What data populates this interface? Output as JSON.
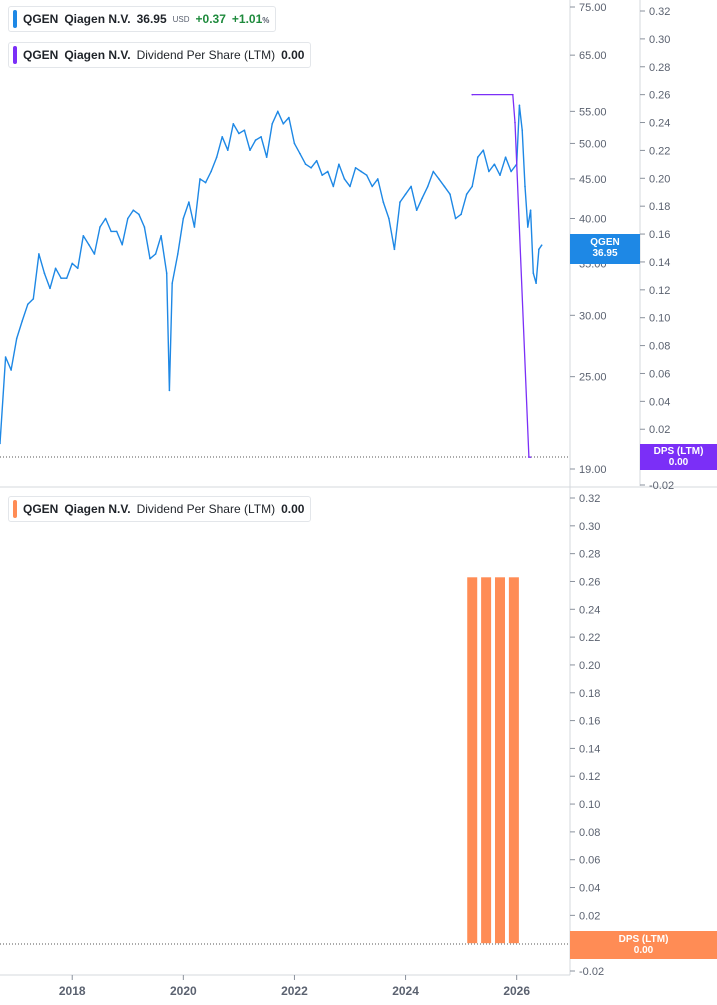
{
  "legends": [
    {
      "symbol": "QGEN",
      "name": "Qiagen N.V.",
      "value": "36.95",
      "currency": "USD",
      "change": "+0.37",
      "change_pct": "+1.01",
      "pct_sign": "%",
      "color": "#1e88e5",
      "change_color": "#1e8a3c"
    },
    {
      "symbol": "QGEN",
      "name": "Qiagen N.V.",
      "metric": "Dividend Per Share (LTM)",
      "value": "0.00",
      "color": "#7b2ff7"
    },
    {
      "symbol": "QGEN",
      "name": "Qiagen N.V.",
      "metric": "Dividend Per Share (LTM)",
      "value": "0.00",
      "color": "#ff8c55"
    }
  ],
  "tags": {
    "price": {
      "line1": "QGEN",
      "line2": "36.95",
      "color": "#1e88e5"
    },
    "dps_top": {
      "line1": "DPS (LTM)",
      "line2": "0.00",
      "color": "#7b2ff7"
    },
    "dps_bottom": {
      "line1": "DPS (LTM)",
      "line2": "0.00",
      "color": "#ff8c55"
    }
  },
  "chart_data": [
    {
      "type": "line",
      "series": [
        {
          "name": "Qiagen N.V.",
          "color": "#1e88e5"
        }
      ],
      "y_scale": "log",
      "y_ticks": [
        19.0,
        25.0,
        30.0,
        35.0,
        40.0,
        45.0,
        50.0,
        55.0,
        65.0,
        75.0
      ],
      "x_ticks": [
        "2018",
        "2020",
        "2022",
        "2024",
        "2026"
      ],
      "x": [
        2016.7,
        2016.8,
        2016.9,
        2017.0,
        2017.1,
        2017.2,
        2017.3,
        2017.4,
        2017.5,
        2017.6,
        2017.7,
        2017.8,
        2017.9,
        2018.0,
        2018.1,
        2018.2,
        2018.3,
        2018.4,
        2018.5,
        2018.6,
        2018.7,
        2018.8,
        2018.9,
        2019.0,
        2019.1,
        2019.2,
        2019.3,
        2019.4,
        2019.5,
        2019.6,
        2019.7,
        2019.75,
        2019.8,
        2019.9,
        2020.0,
        2020.1,
        2020.2,
        2020.3,
        2020.4,
        2020.5,
        2020.6,
        2020.7,
        2020.8,
        2020.9,
        2021.0,
        2021.1,
        2021.2,
        2021.3,
        2021.4,
        2021.5,
        2021.6,
        2021.7,
        2021.8,
        2021.9,
        2022.0,
        2022.1,
        2022.2,
        2022.3,
        2022.4,
        2022.5,
        2022.6,
        2022.7,
        2022.8,
        2022.9,
        2023.0,
        2023.1,
        2023.2,
        2023.3,
        2023.4,
        2023.5,
        2023.6,
        2023.7,
        2023.8,
        2023.9,
        2024.0,
        2024.1,
        2024.2,
        2024.3,
        2024.4,
        2024.5,
        2024.6,
        2024.7,
        2024.8,
        2024.9,
        2025.0,
        2025.1,
        2025.2,
        2025.3,
        2025.4,
        2025.5,
        2025.6,
        2025.7,
        2025.8,
        2025.9,
        2026.0,
        2026.05,
        2026.1,
        2026.15,
        2026.2,
        2026.25,
        2026.3,
        2026.35,
        2026.4,
        2026.45
      ],
      "y": [
        20.5,
        26.5,
        25.5,
        28.0,
        29.5,
        31.0,
        31.5,
        36.0,
        34.0,
        32.5,
        34.5,
        33.5,
        33.5,
        35.0,
        34.5,
        38.0,
        37.0,
        36.0,
        39.0,
        40.0,
        38.5,
        38.5,
        37.0,
        40.0,
        41.0,
        40.5,
        39.0,
        35.5,
        36.0,
        38.0,
        34.0,
        24.0,
        33.0,
        36.0,
        40.0,
        42.0,
        39.0,
        45.0,
        44.5,
        46.0,
        48.0,
        51.0,
        49.0,
        53.0,
        51.5,
        52.0,
        49.0,
        50.5,
        51.0,
        48.0,
        53.0,
        55.0,
        53.0,
        54.0,
        50.0,
        48.5,
        47.0,
        46.5,
        47.5,
        45.5,
        46.0,
        44.0,
        47.0,
        45.0,
        44.0,
        46.5,
        46.0,
        45.5,
        44.0,
        45.0,
        42.0,
        40.0,
        36.5,
        42.0,
        43.0,
        44.0,
        41.0,
        42.5,
        44.0,
        46.0,
        45.0,
        44.0,
        43.0,
        40.0,
        40.5,
        43.0,
        44.0,
        48.0,
        49.0,
        46.0,
        47.0,
        45.5,
        48.0,
        46.0,
        47.0,
        56.0,
        52.0,
        44.0,
        39.0,
        41.0,
        34.0,
        33.0,
        36.5,
        36.95
      ]
    },
    {
      "type": "line",
      "series": [
        {
          "name": "Dividend Per Share (LTM)",
          "color": "#7b2ff7"
        }
      ],
      "y_ticks": [
        -0.02,
        0.02,
        0.04,
        0.06,
        0.08,
        0.1,
        0.12,
        0.14,
        0.16,
        0.18,
        0.2,
        0.22,
        0.24,
        0.26,
        0.28,
        0.3,
        0.32
      ],
      "x": [
        2025.2,
        2025.93,
        2025.97,
        2026.22,
        2026.25
      ],
      "y": [
        0.26,
        0.26,
        0.24,
        0.0,
        0.0
      ]
    },
    {
      "type": "bar",
      "series": [
        {
          "name": "Dividend Per Share (LTM)",
          "color": "#ff8c55"
        }
      ],
      "y_ticks": [
        -0.02,
        0.02,
        0.04,
        0.06,
        0.08,
        0.1,
        0.12,
        0.14,
        0.16,
        0.18,
        0.2,
        0.22,
        0.24,
        0.26,
        0.28,
        0.3,
        0.32
      ],
      "x": [
        2025.2,
        2025.45,
        2025.7,
        2025.95
      ],
      "values": [
        0.263,
        0.263,
        0.263,
        0.263
      ]
    }
  ]
}
